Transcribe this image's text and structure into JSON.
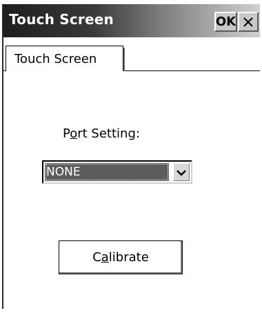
{
  "window": {
    "title": "Touch Screen",
    "ok_label": "OK"
  },
  "tabs": [
    {
      "label": "Touch Screen",
      "selected": true
    }
  ],
  "port": {
    "label_before": "P",
    "label_mnemonic": "o",
    "label_after": "rt Setting:",
    "selected_value": "NONE"
  },
  "calibrate": {
    "label_before": "C",
    "label_mnemonic": "a",
    "label_after": "librate"
  },
  "icons": {
    "close": "close-icon",
    "dropdown": "chevron-down-icon"
  },
  "colors": {
    "title_text": "#ffffff",
    "selection_bg": "#5c5c5c",
    "button_face": "#c8c8c8"
  }
}
